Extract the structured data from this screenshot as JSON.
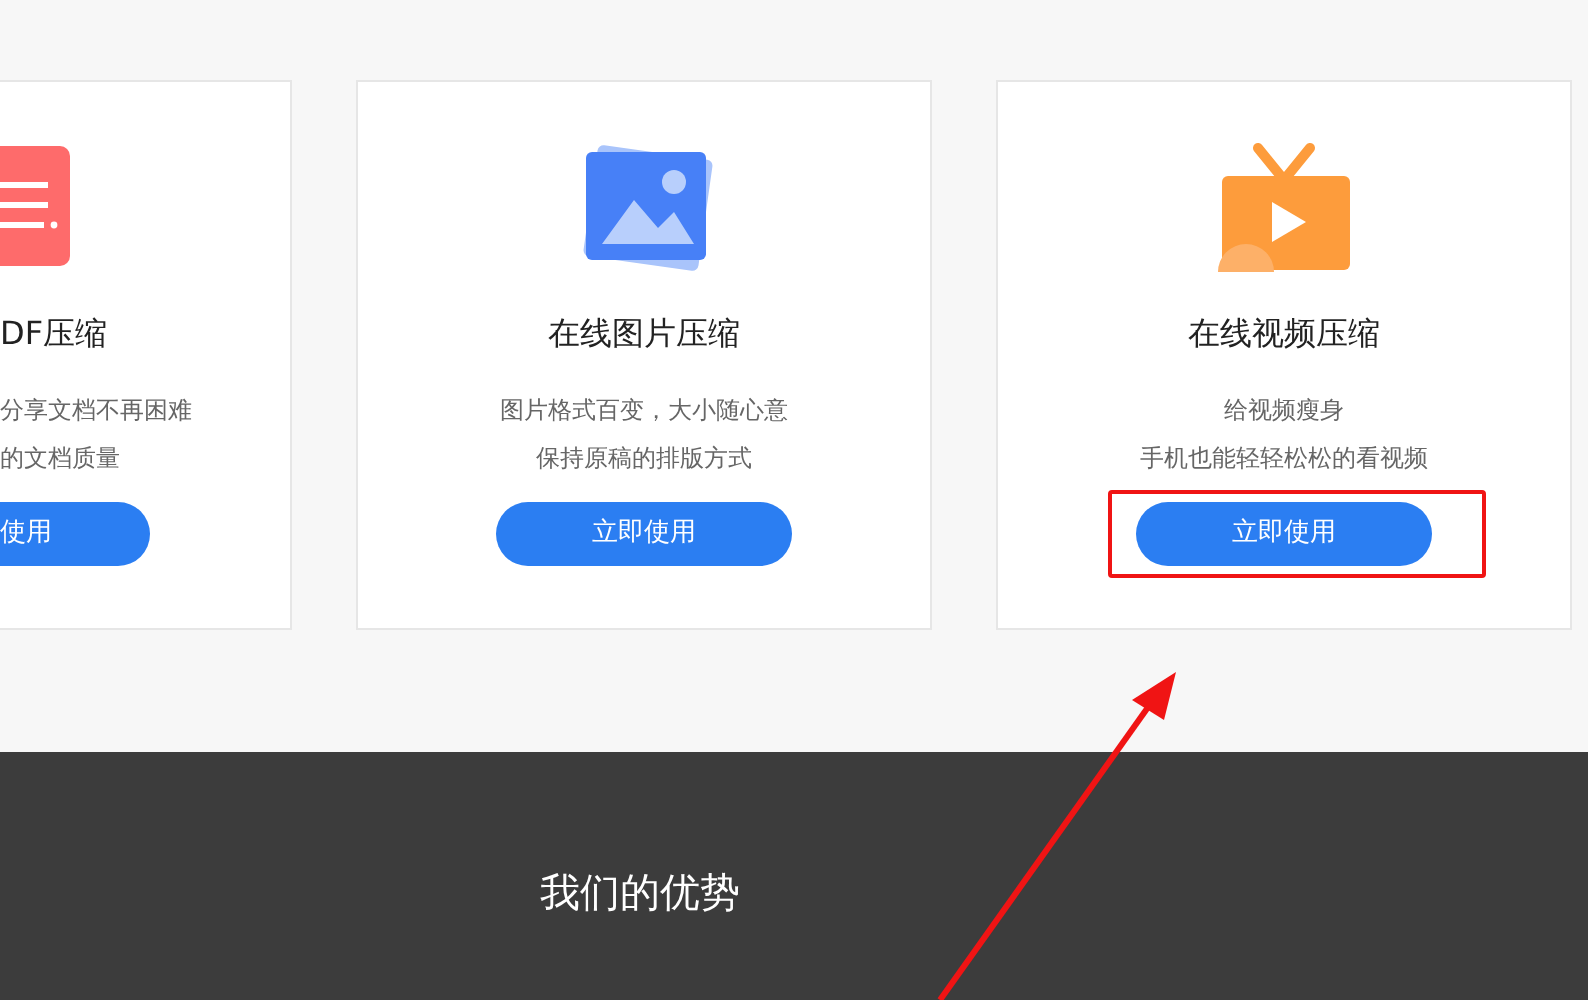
{
  "cards": [
    {
      "kind": "cut_off",
      "title": "DF压缩",
      "lines": [
        "分享文档不再困难",
        "的文档质量"
      ],
      "button": {
        "label": "使用",
        "highlighted": false
      }
    },
    {
      "kind": "full",
      "title": "在线图片压缩",
      "lines": [
        "图片格式百变，大小随心意",
        "保持原稿的排版方式"
      ],
      "button": {
        "label": "立即使用",
        "highlighted": false
      }
    },
    {
      "kind": "full",
      "title": "在线视频压缩",
      "lines": [
        "给视频瘦身",
        "手机也能轻轻松松的看视频"
      ],
      "button": {
        "label": "立即使用",
        "highlighted": true
      }
    }
  ],
  "advantages": {
    "title": "我们的优势"
  }
}
